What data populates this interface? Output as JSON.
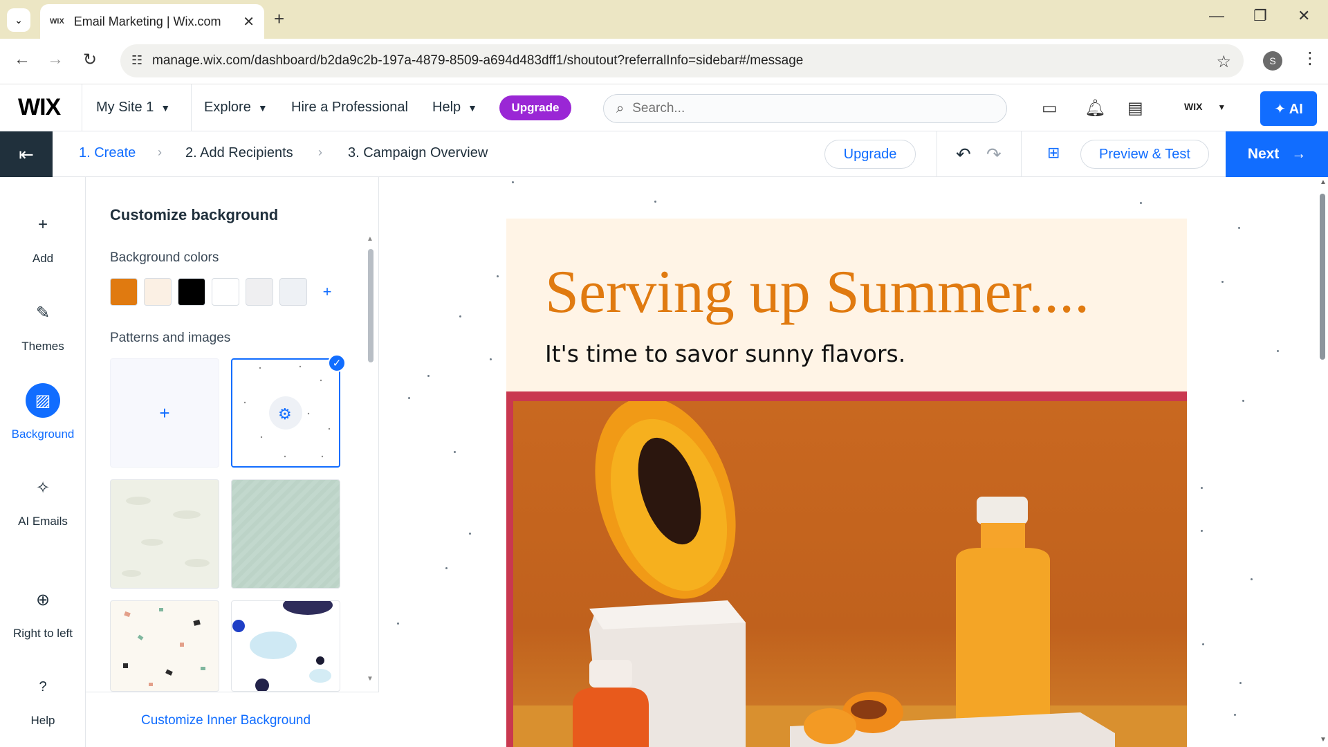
{
  "browser": {
    "tab_title": "Email Marketing | Wix.com",
    "tab_favicon": "WIX",
    "url": "manage.wix.com/dashboard/b2da9c2b-197a-4879-8509-a694d483dff1/shoutout?referralInfo=sidebar#/message",
    "profile_initial": "S"
  },
  "wixbar": {
    "logo": "WIX",
    "site_name": "My Site 1",
    "explore": "Explore",
    "hire": "Hire a Professional",
    "help": "Help",
    "upgrade": "Upgrade",
    "search_placeholder": "Search...",
    "account_label": "WIX",
    "ai_label": "AI"
  },
  "steps": {
    "items": [
      "1. Create",
      "2. Add Recipients",
      "3. Campaign Overview"
    ],
    "upgrade": "Upgrade",
    "preview": "Preview & Test",
    "next": "Next"
  },
  "rail": {
    "items": [
      {
        "label": "Add",
        "icon": "plus-icon"
      },
      {
        "label": "Themes",
        "icon": "brush-icon"
      },
      {
        "label": "Background",
        "icon": "background-icon"
      },
      {
        "label": "AI Emails",
        "icon": "sparkle-icon"
      },
      {
        "label": "Right to left",
        "icon": "globe-icon"
      },
      {
        "label": "Help",
        "icon": "question-icon"
      }
    ]
  },
  "panel": {
    "title": "Customize background",
    "colors_label": "Background colors",
    "colors": [
      "#e07a10",
      "#fbf0e4",
      "#000000",
      "#ffffff",
      "#efeff1",
      "#eef1f5"
    ],
    "patterns_label": "Patterns and images",
    "inner_link": "Customize Inner Background"
  },
  "email": {
    "headline": "Serving up Summer....",
    "subhead": "It's time to savor sunny flavors."
  },
  "colors": {
    "accent": "#116dff",
    "upgrade_purple": "#9a27d5",
    "headline_orange": "#e07a10",
    "hero_frame": "#c9384f"
  }
}
